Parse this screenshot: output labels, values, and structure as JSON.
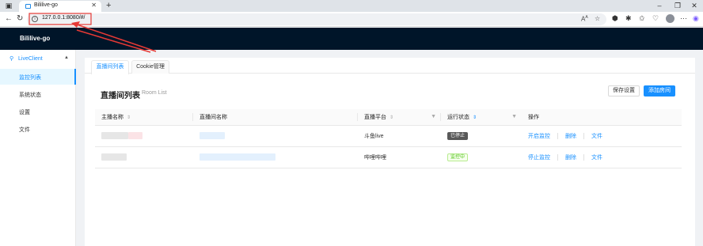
{
  "browser": {
    "tab_title": "Bililive-go",
    "tab_close": "✕",
    "new_tab": "+",
    "url": "127.0.0.1:8080/#/",
    "window_controls": {
      "minimize": "–",
      "maximize": "❐",
      "close": "✕"
    },
    "nav": {
      "back": "←",
      "reload": "↻"
    }
  },
  "app": {
    "title": "Bililive-go"
  },
  "sidebar": {
    "group_label": "LiveClient",
    "group_icon": "key-icon",
    "items": [
      {
        "label": "监控列表",
        "active": true
      },
      {
        "label": "系统状态",
        "active": false
      },
      {
        "label": "设置",
        "active": false
      },
      {
        "label": "文件",
        "active": false
      }
    ]
  },
  "tabs": [
    {
      "label": "直播间列表",
      "active": true
    },
    {
      "label": "Cookie管理",
      "active": false
    }
  ],
  "card": {
    "title": "直播间列表",
    "subtitle": "Room List",
    "save_button": "保存设置",
    "add_button": "添加房间"
  },
  "table": {
    "columns": [
      "主播名称",
      "直播间名称",
      "直播平台",
      "运行状态",
      "操作"
    ],
    "rows": [
      {
        "platform": "斗鱼live",
        "status": "已停止",
        "status_type": "stopped",
        "actions": [
          "开启监控",
          "删除",
          "文件"
        ]
      },
      {
        "platform": "哔哩哔哩",
        "status": "监控中",
        "status_type": "monitoring",
        "actions": [
          "停止监控",
          "删除",
          "文件"
        ]
      }
    ]
  },
  "colors": {
    "header_bg": "#001529",
    "accent": "#1890ff",
    "annotation": "#e53935"
  }
}
